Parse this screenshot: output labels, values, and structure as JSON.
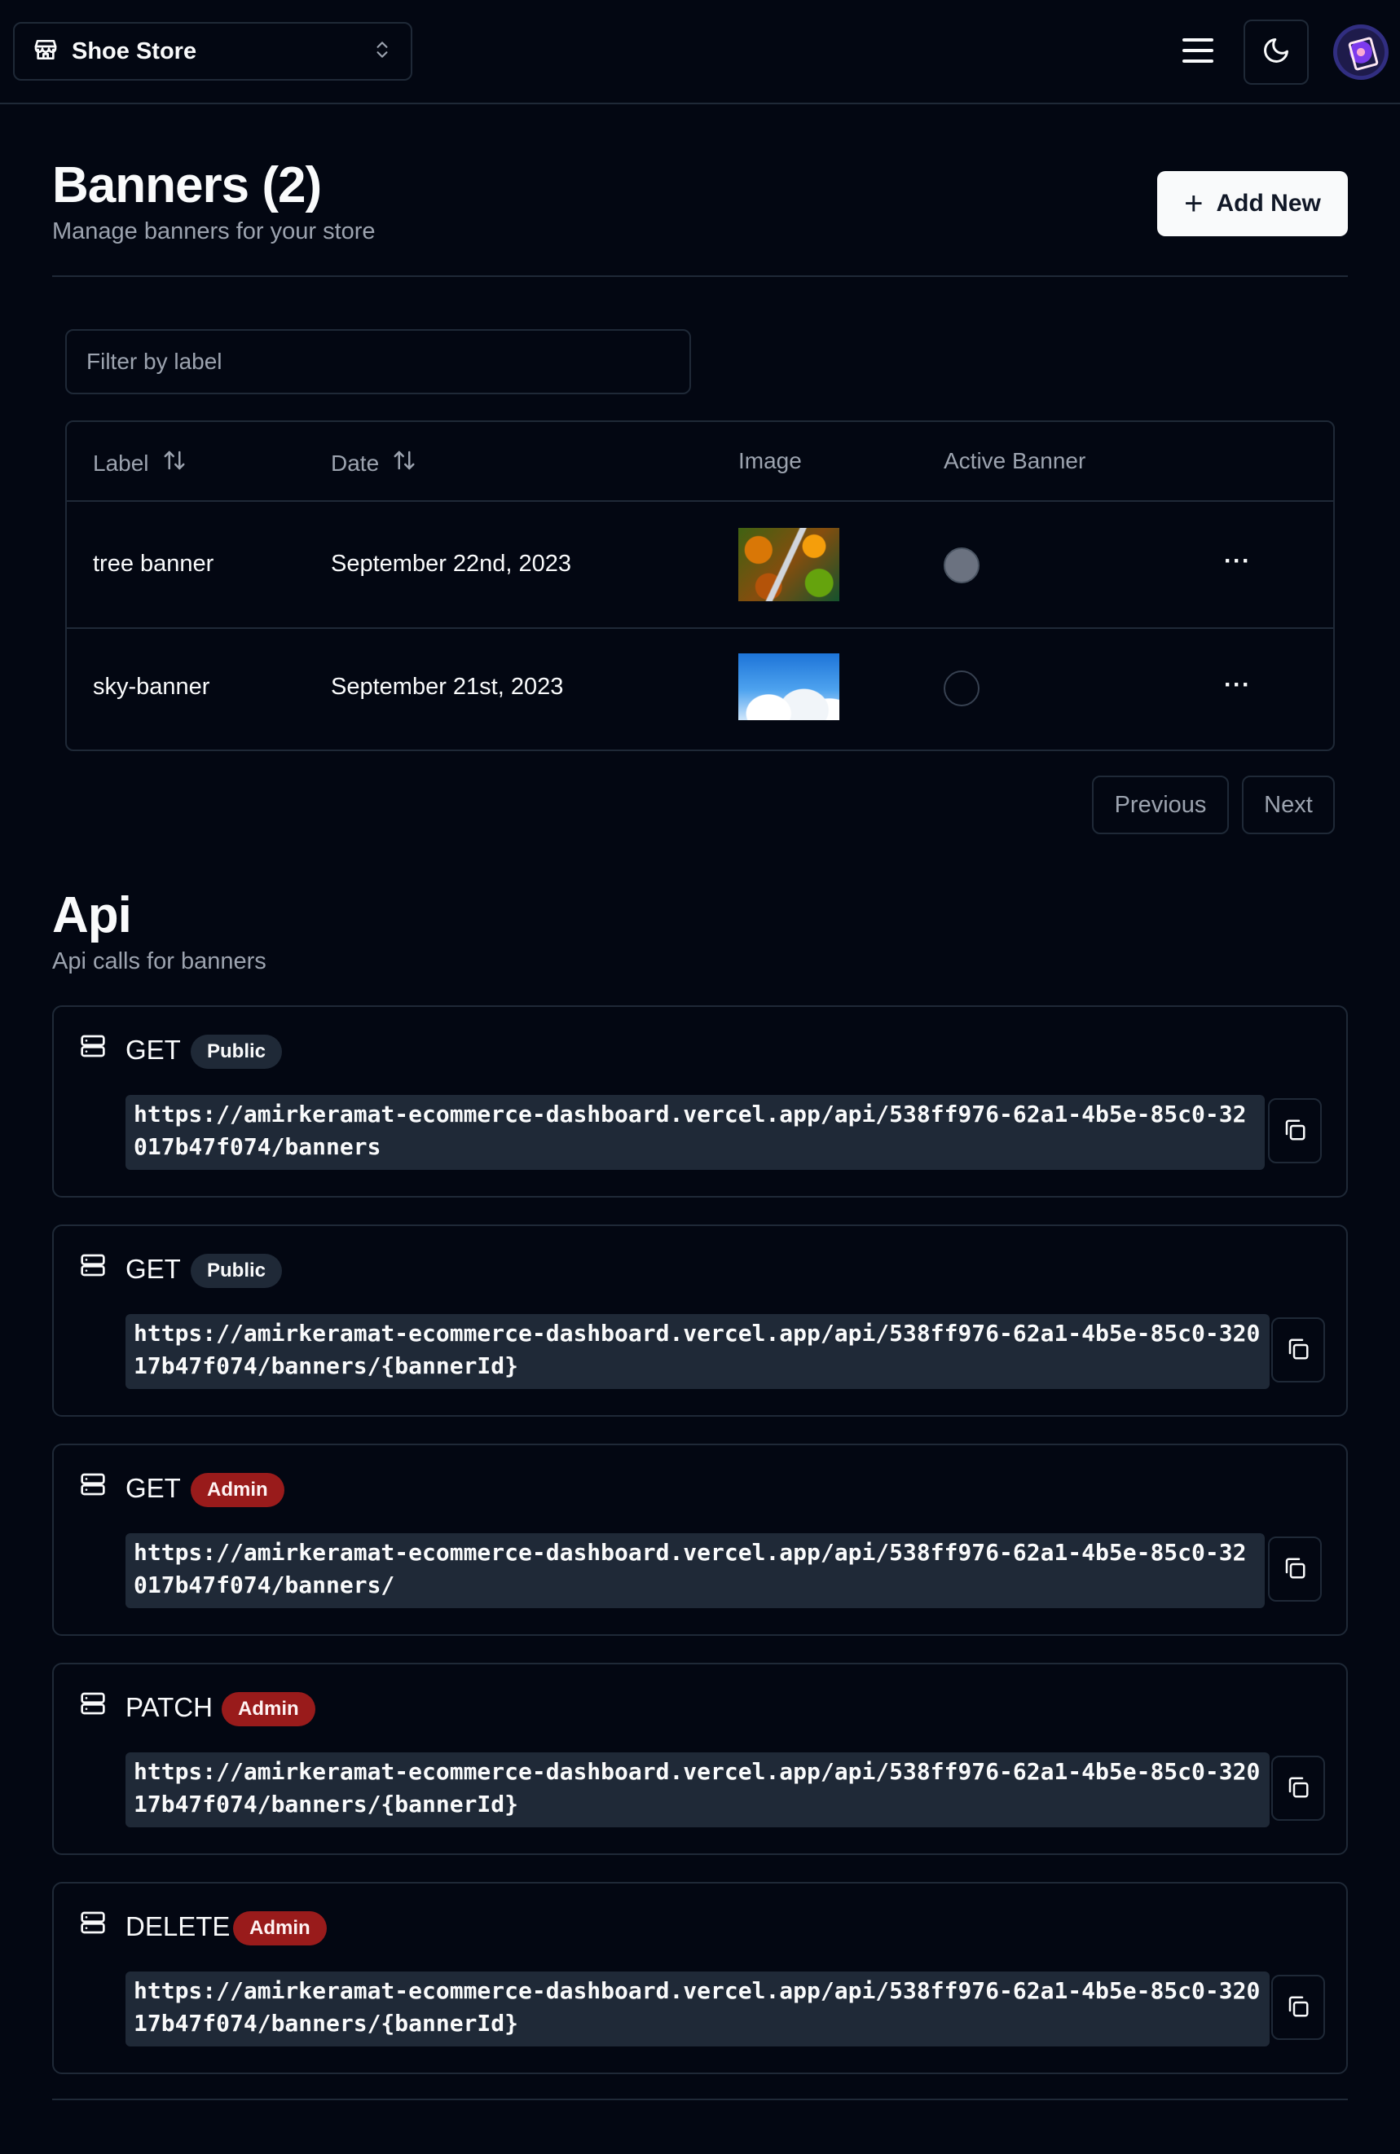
{
  "header": {
    "store_name": "Shoe Store"
  },
  "page": {
    "title": "Banners (2)",
    "subtitle": "Manage banners for your store",
    "add_button_label": "Add New"
  },
  "filter": {
    "placeholder": "Filter by label"
  },
  "table": {
    "columns": [
      "Label",
      "Date",
      "Image",
      "Active Banner"
    ],
    "rows": [
      {
        "label": "tree banner",
        "date": "September 22nd, 2023",
        "image": "tree aerial photo",
        "active": true
      },
      {
        "label": "sky-banner",
        "date": "September 21st, 2023",
        "image": "blue sky clouds photo",
        "active": false
      }
    ],
    "more_label": "···"
  },
  "pagination": {
    "previous_label": "Previous",
    "next_label": "Next"
  },
  "api": {
    "title": "Api",
    "subtitle": "Api calls for banners",
    "calls": [
      {
        "method": "GET",
        "access": "Public",
        "url": "https://amirkeramat-ecommerce-dashboard.vercel.app/api/538ff976-62a1-4b5e-85c0-32017b47f074/banners"
      },
      {
        "method": "GET",
        "access": "Public",
        "url": "https://amirkeramat-ecommerce-dashboard.vercel.app/api/538ff976-62a1-4b5e-85c0-32017b47f074/banners/{bannerId}"
      },
      {
        "method": "GET",
        "access": "Admin",
        "url": "https://amirkeramat-ecommerce-dashboard.vercel.app/api/538ff976-62a1-4b5e-85c0-32017b47f074/banners/"
      },
      {
        "method": "PATCH",
        "access": "Admin",
        "url": "https://amirkeramat-ecommerce-dashboard.vercel.app/api/538ff976-62a1-4b5e-85c0-32017b47f074/banners/{bannerId}"
      },
      {
        "method": "DELETE",
        "access": "Admin",
        "url": "https://amirkeramat-ecommerce-dashboard.vercel.app/api/538ff976-62a1-4b5e-85c0-32017b47f074/banners/{bannerId}"
      }
    ]
  },
  "colors": {
    "background": "#030712",
    "border": "#1f2937",
    "muted_text": "#9ca3af",
    "admin_badge": "#991b1b",
    "public_badge": "#1f2937"
  },
  "icons": [
    "store-icon",
    "chevrons-up-down-icon",
    "menu-icon",
    "moon-icon",
    "plus-icon",
    "sort-icon",
    "more-horizontal-icon",
    "server-icon",
    "copy-icon"
  ]
}
